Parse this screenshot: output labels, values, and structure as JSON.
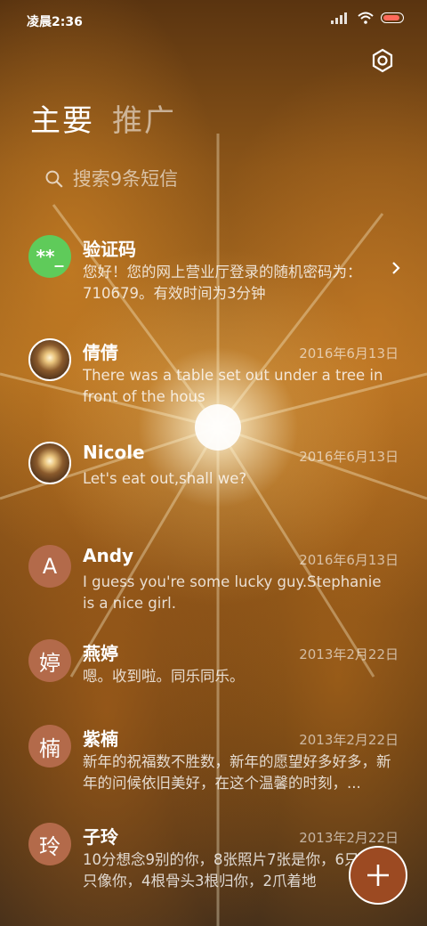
{
  "status": {
    "time": "凌晨2:36"
  },
  "tabs": [
    {
      "label": "主要"
    },
    {
      "label": "推广"
    }
  ],
  "search": {
    "placeholder": "搜索9条短信"
  },
  "messages": [
    {
      "avatar": "**_",
      "name": "验证码",
      "date": "",
      "snippet": "您好！您的网上营业厅登录的随机密码为：710679。有效时间为3分钟"
    },
    {
      "avatar": "",
      "name": "倩倩",
      "date": "2016年6月13日",
      "snippet": "There was a table set out under a tree in front of the hous"
    },
    {
      "avatar": "",
      "name": "Nicole",
      "date": "2016年6月13日",
      "snippet": "Let's eat out,shall we?"
    },
    {
      "avatar": "A",
      "name": "Andy",
      "date": "2016年6月13日",
      "snippet": "I guess you're some lucky guy.Stephanie is a nice girl."
    },
    {
      "avatar": "婷",
      "name": "燕婷",
      "date": "2013年2月22日",
      "snippet": "嗯。收到啦。同乐同乐。"
    },
    {
      "avatar": "楠",
      "name": "紫楠",
      "date": "2013年2月22日",
      "snippet": "新年的祝福数不胜数，新年的愿望好多好多，新年的问候依旧美好，在这个温馨的时刻，..."
    },
    {
      "avatar": "玲",
      "name": "子玲",
      "date": "2013年2月22日",
      "snippet": "10分想念9别的你，8张照片7张是你，6只狗5只像你，4根骨头3根归你，2爪着地"
    }
  ],
  "icons": {
    "settings": "settings-icon",
    "search": "search-icon",
    "compose": "plus-icon",
    "chevron": "chevron-right-icon"
  },
  "colors": {
    "fab": "#9c4a22",
    "letter_avatar": "#b36a4a",
    "green_avatar": "#5fcb5a"
  }
}
